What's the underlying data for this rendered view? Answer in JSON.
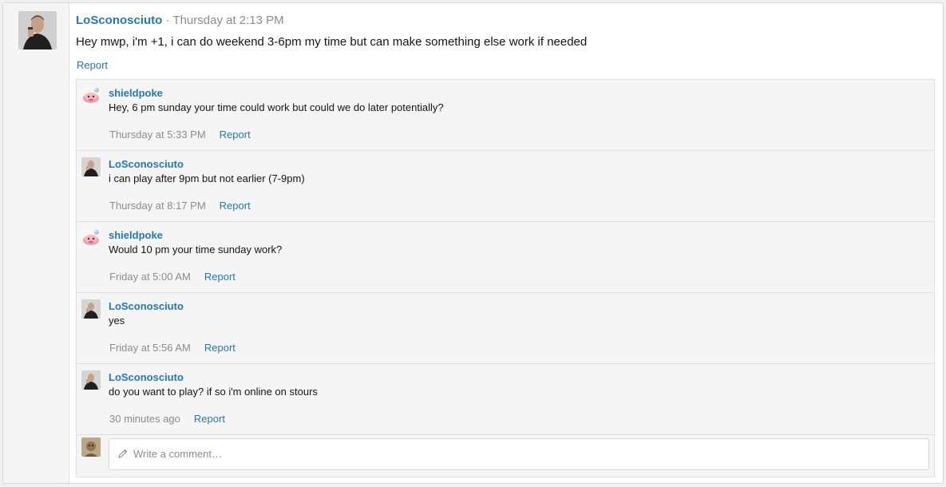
{
  "post": {
    "author": "LoSconosciuto",
    "separator": "·",
    "time": "Thursday at 2:13 PM",
    "message": "Hey mwp, i'm +1, i can do weekend 3-6pm my time but can make something else work if needed",
    "report_label": "Report"
  },
  "comments": [
    {
      "author": "shieldpoke",
      "text": "Hey, 6 pm sunday your time could work but could we do later potentially?",
      "time": "Thursday at 5:33 PM",
      "report_label": "Report",
      "avatar": "pink-cartoon-avatar"
    },
    {
      "author": "LoSconosciuto",
      "text": "i can play after 9pm but not earlier (7-9pm)",
      "time": "Thursday at 8:17 PM",
      "report_label": "Report",
      "avatar": "man-photo-avatar"
    },
    {
      "author": "shieldpoke",
      "text": "Would 10 pm your time sunday work?",
      "time": "Friday at 5:00 AM",
      "report_label": "Report",
      "avatar": "pink-cartoon-avatar"
    },
    {
      "author": "LoSconosciuto",
      "text": "yes",
      "time": "Friday at 5:56 AM",
      "report_label": "Report",
      "avatar": "man-photo-avatar"
    },
    {
      "author": "LoSconosciuto",
      "text": "do you want to play? if so i'm online on stours",
      "time": "30 minutes ago",
      "report_label": "Report",
      "avatar": "man-photo-avatar"
    }
  ],
  "reply": {
    "placeholder": "Write a comment…"
  },
  "colors": {
    "link": "#2577b1",
    "muted": "#8c8c8c",
    "panel": "#f5f5f5",
    "border": "#dfdfdf"
  }
}
